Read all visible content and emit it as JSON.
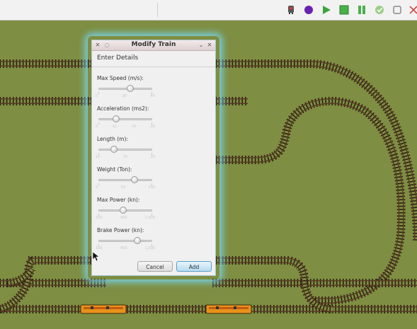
{
  "toolbar": {
    "icons": [
      "train-icon",
      "record-icon",
      "play-icon",
      "stop-icon",
      "pause-icon",
      "check-icon",
      "restore-icon",
      "close-icon"
    ]
  },
  "dialog": {
    "title": "Modify Train",
    "section_title": "Enter Details",
    "fields": [
      {
        "label": "Max Speed (m/s):",
        "value_fraction": 0.6,
        "tick_labels": [
          "0",
          "20",
          "40"
        ]
      },
      {
        "label": "Acceleration (ms2):",
        "value_fraction": 0.3,
        "tick_labels": [
          "0",
          "12",
          "24",
          "20"
        ]
      },
      {
        "label": "Length (m):",
        "value_fraction": 0.25,
        "tick_labels": [
          "10",
          "15",
          "20"
        ]
      },
      {
        "label": "Weight (Ton):",
        "value_fraction": 0.7,
        "tick_labels": [
          "0",
          "50",
          "100"
        ]
      },
      {
        "label": "Max Power (kn):",
        "value_fraction": 0.45,
        "tick_labels": [
          "100",
          "450",
          "1,000"
        ]
      },
      {
        "label": "Brake Power (kn):",
        "value_fraction": 0.75,
        "tick_labels": [
          "100",
          "400",
          "1,000"
        ]
      }
    ],
    "cancel_label": "Cancel",
    "add_label": "Add"
  },
  "colors": {
    "grass": "#7e8e42",
    "rail": "#5a3a22",
    "sleeper": "#2a1d14",
    "train": "#e8921a",
    "glow": "#78dcff"
  }
}
